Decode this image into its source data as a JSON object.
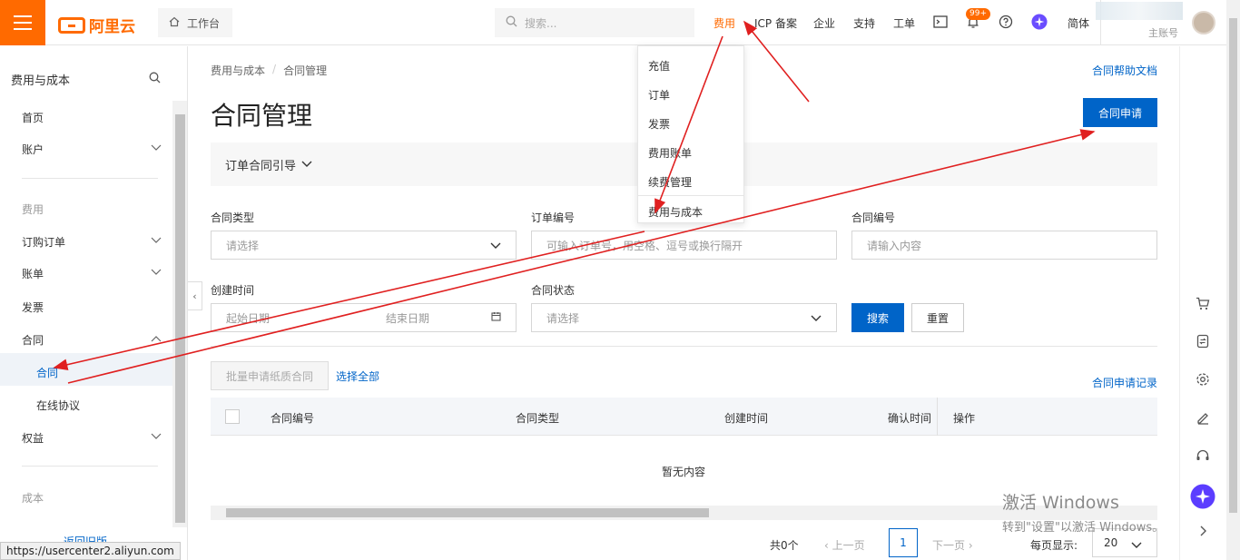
{
  "topbar": {
    "brand": "阿里云",
    "workbench_label": "工作台",
    "search_placeholder": "搜索...",
    "nav": [
      "费用",
      "ICP 备案",
      "企业",
      "支持",
      "工单"
    ],
    "badge": "99+",
    "language": "简体",
    "account_name": "主账号",
    "accent_color": "#ff6a00"
  },
  "fee_dropdown": {
    "items": [
      "充值",
      "订单",
      "发票",
      "费用账单",
      "续费管理",
      "费用与成本"
    ]
  },
  "sidebar": {
    "title": "费用与成本",
    "items": {
      "home": "首页",
      "account": "账户",
      "fee_group": "费用",
      "orders": "订购订单",
      "bill": "账单",
      "invoice": "发票",
      "contract": "合同",
      "contract_sub": "合同",
      "online_agreement": "在线协议",
      "rights": "权益",
      "cost_group": "成本",
      "back": "返回旧版"
    }
  },
  "status_url": "https://usercenter2.aliyun.com",
  "main": {
    "breadcrumb": [
      "费用与成本",
      "合同管理"
    ],
    "help_link": "合同帮助文档",
    "title": "合同管理",
    "apply_button": "合同申请",
    "guide_label": "订单合同引导",
    "filters": {
      "type_label": "合同类型",
      "type_placeholder": "请选择",
      "order_no_label": "订单编号",
      "order_no_placeholder": "可输入订单号，用空格、逗号或换行隔开",
      "contract_no_label": "合同编号",
      "contract_no_placeholder": "请输入内容",
      "created_label": "创建时间",
      "start_placeholder": "起始日期",
      "end_placeholder": "结束日期",
      "status_label": "合同状态",
      "status_placeholder": "请选择",
      "search_button": "搜索",
      "reset_button": "重置"
    },
    "batch_button": "批量申请纸质合同",
    "select_all": "选择全部",
    "records_link": "合同申请记录",
    "table": {
      "columns": [
        "合同编号",
        "合同类型",
        "创建时间",
        "确认时间",
        "操作"
      ],
      "empty": "暂无内容"
    },
    "pager": {
      "total": "共0个",
      "prev": "上一页",
      "page": "1",
      "next": "下一页",
      "per_page_label": "每页显示:",
      "per_page_value": "20"
    }
  },
  "watermark": {
    "line1": "激活 Windows",
    "line2": "转到\"设置\"以激活 Windows。"
  },
  "annotation_color": "#e02020"
}
